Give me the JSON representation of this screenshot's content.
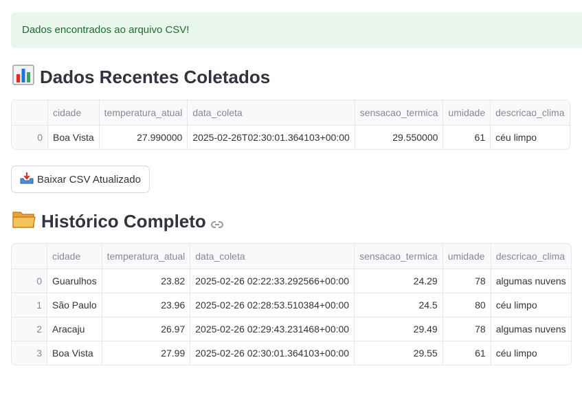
{
  "alert": {
    "text": "Dados encontrados ao arquivo CSV!"
  },
  "recent": {
    "title": "Dados Recentes Coletados",
    "icon": "bar-chart-icon",
    "columns": [
      "",
      "cidade",
      "temperatura_atual",
      "data_coleta",
      "sensacao_termica",
      "umidade",
      "descricao_clima"
    ],
    "rows": [
      [
        "0",
        "Boa Vista",
        "27.990000",
        "2025-02-26T02:30:01.364103+00:00",
        "29.550000",
        "61",
        "céu limpo"
      ]
    ]
  },
  "download_button": {
    "label": "Baixar CSV Atualizado",
    "icon": "inbox-tray-icon"
  },
  "history": {
    "title": "Histórico Completo",
    "icon": "folder-icon",
    "link_icon": "link-icon",
    "columns": [
      "",
      "cidade",
      "temperatura_atual",
      "data_coleta",
      "sensacao_termica",
      "umidade",
      "descricao_clima"
    ],
    "rows": [
      [
        "0",
        "Guarulhos",
        "23.82",
        "2025-02-26 02:22:33.292566+00:00",
        "24.29",
        "78",
        "algumas nuvens"
      ],
      [
        "1",
        "São Paulo",
        "23.96",
        "2025-02-26 02:28:53.510384+00:00",
        "24.5",
        "80",
        "céu limpo"
      ],
      [
        "2",
        "Aracaju",
        "26.97",
        "2025-02-26 02:29:43.231468+00:00",
        "29.49",
        "78",
        "algumas nuvens"
      ],
      [
        "3",
        "Boa Vista",
        "27.99",
        "2025-02-26 02:30:01.364103+00:00",
        "29.55",
        "61",
        "céu limpo"
      ]
    ]
  }
}
